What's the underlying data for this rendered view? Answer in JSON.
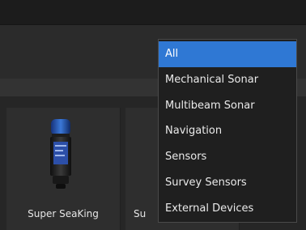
{
  "devices": [
    {
      "label": "Super SeaKing",
      "icon": "sonar-device-icon"
    },
    {
      "label": "Su",
      "icon": "device-icon"
    }
  ],
  "dropdown": {
    "selected": "All",
    "options": [
      "All",
      "Mechanical Sonar",
      "Multibeam Sonar",
      "Navigation",
      "Sensors",
      "Survey Sensors",
      "External Devices"
    ]
  },
  "colors": {
    "selection": "#2f78d4",
    "background": "#1f1f1f",
    "card": "#2e2e2e"
  }
}
